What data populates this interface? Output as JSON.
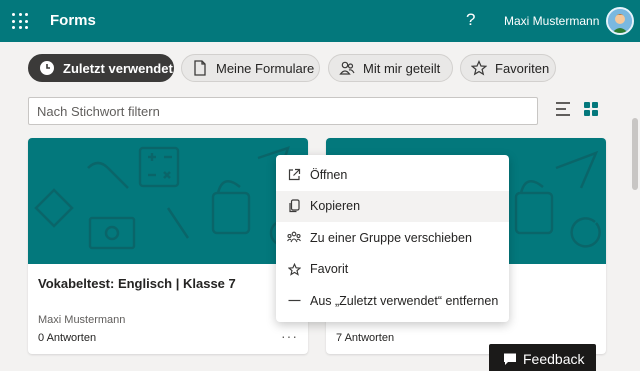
{
  "header": {
    "app_title": "Forms",
    "help_label": "?",
    "user_name": "Maxi Mustermann"
  },
  "filters": [
    {
      "label": "Zuletzt verwendet",
      "icon": "clock-icon",
      "active": true
    },
    {
      "label": "Meine Formulare",
      "icon": "document-icon",
      "active": false
    },
    {
      "label": "Mit mir geteilt",
      "icon": "people-icon",
      "active": false
    },
    {
      "label": "Favoriten",
      "icon": "star-icon",
      "active": false
    }
  ],
  "search": {
    "placeholder": "Nach Stichwort filtern"
  },
  "colors": {
    "brand": "#03787c",
    "active_pill": "#3b3a39"
  },
  "cards": [
    {
      "title": "Vokabeltest: Englisch | Klasse 7",
      "owner": "Maxi Mustermann",
      "answers": "0 Antworten",
      "more": "···"
    },
    {
      "title": "",
      "owner": "",
      "answers": "7 Antworten"
    }
  ],
  "context_menu": {
    "items": [
      {
        "label": "Öffnen",
        "icon": "open-external-icon"
      },
      {
        "label": "Kopieren",
        "icon": "copy-icon"
      },
      {
        "label": "Zu einer Gruppe verschieben",
        "icon": "group-move-icon"
      },
      {
        "label": "Favorit",
        "icon": "star-icon"
      },
      {
        "label": "Aus „Zuletzt verwendet“ entfernen",
        "icon": "remove-icon"
      }
    ]
  },
  "feedback": {
    "label": "Feedback"
  }
}
